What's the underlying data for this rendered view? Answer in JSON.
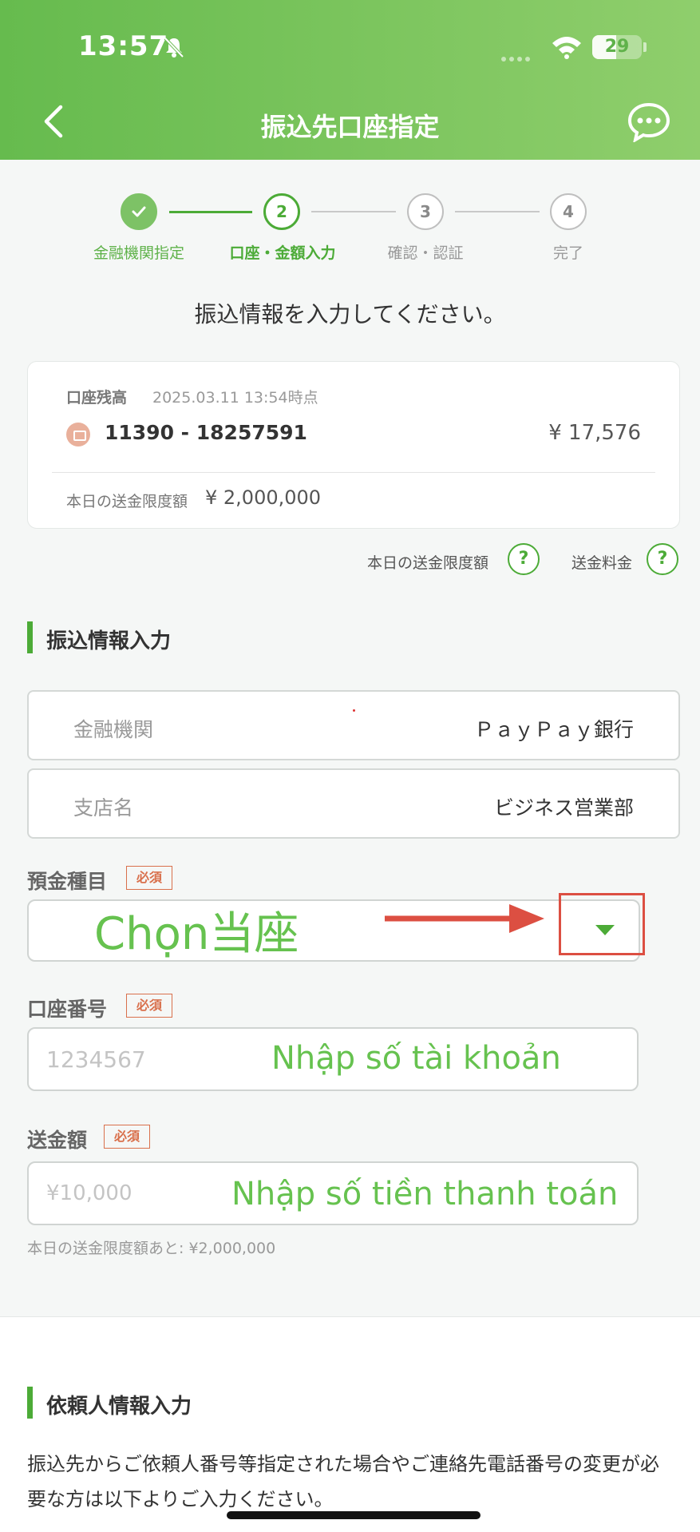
{
  "status_bar": {
    "time": "13:57",
    "battery": "29"
  },
  "header": {
    "title": "振込先口座指定"
  },
  "stepper": {
    "steps": [
      {
        "number": "1",
        "label": "金融機関指定",
        "state": "done"
      },
      {
        "number": "2",
        "label": "口座・金額入力",
        "state": "active"
      },
      {
        "number": "3",
        "label": "確認・認証",
        "state": "pending"
      },
      {
        "number": "4",
        "label": "完了",
        "state": "pending"
      }
    ]
  },
  "instruction": "振込情報を入力してください。",
  "account": {
    "balance_label": "口座残高",
    "balance_time": "2025.03.11 13:54時点",
    "number": "11390 - 18257591",
    "balance": "¥ 17,576",
    "limit_label": "本日の送金限度額",
    "limit_value": "¥ 2,000,000"
  },
  "help": {
    "limit_label": "本日の送金限度額",
    "fee_label": "送金料金",
    "icon_text": "?"
  },
  "transfer_section": {
    "title": "振込情報入力",
    "bank_label": "金融機関",
    "bank_value": "ＰａｙＰａｙ銀行",
    "branch_label": "支店名",
    "branch_value": "ビジネス営業部",
    "deposit_type_label": "預金種目",
    "account_number_label": "口座番号",
    "account_number_placeholder": "1234567",
    "amount_label": "送金額",
    "amount_placeholder": "¥10,000",
    "required_badge": "必須",
    "remaining_hint": "本日の送金限度額あと: ¥2,000,000"
  },
  "annotations": {
    "select_type": "Chọn当座",
    "enter_account": "Nhập số tài khoản",
    "enter_amount": "Nhập số tiền thanh toán"
  },
  "requester_section": {
    "title": "依頼人情報入力",
    "line1": "振込先からご依頼人番号等指定された場合やご連絡先電話番号の変更が必",
    "line2": "要な方は以下よりご入力ください。"
  },
  "colors": {
    "brand_green": "#4cab37",
    "header_green": "#66bb4e",
    "required_orange": "#d9704c",
    "annotation_red": "#dc4f42",
    "annotation_green": "#66c24f"
  }
}
